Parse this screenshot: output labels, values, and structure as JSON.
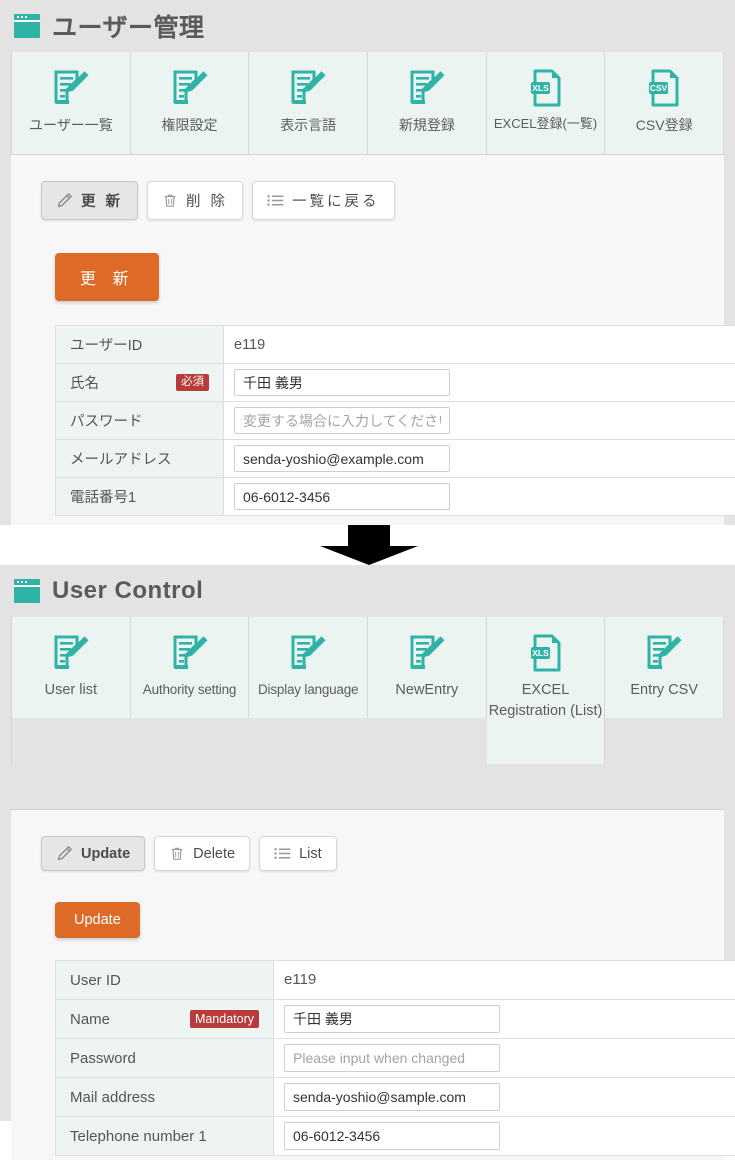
{
  "theme": {
    "accent_teal": "#2fb3a7",
    "orange": "#dd6b27",
    "required_red": "#b93a3a",
    "panel_gray": "#e3e3e3",
    "tab_mint": "#ecf4f2",
    "content_bg": "#f7f7f7"
  },
  "japanese_panel": {
    "window_icon": "window-icon",
    "title": "ユーザー管理",
    "tabs": [
      {
        "label": "ユーザー一覧",
        "icon": "document-pencil-icon"
      },
      {
        "label": "権限設定",
        "icon": "document-pencil-icon"
      },
      {
        "label": "表示言語",
        "icon": "document-pencil-icon"
      },
      {
        "label": "新規登録",
        "icon": "document-pencil-icon"
      },
      {
        "label": "EXCEL登録(一覧)",
        "icon": "xls-file-icon",
        "badge": "XLS"
      },
      {
        "label": "CSV登録",
        "icon": "csv-file-icon",
        "badge": "CSV"
      }
    ],
    "toolbar": [
      {
        "label": "更 新",
        "icon": "pencil-icon",
        "active": true
      },
      {
        "label": "削 除",
        "icon": "trash-icon",
        "active": false
      },
      {
        "label": "一覧に戻る",
        "icon": "list-icon",
        "active": false
      }
    ],
    "submit_button": "更 新",
    "required_badge": "必須",
    "form_rows": [
      {
        "label": "ユーザーID",
        "type": "static",
        "value": "e119",
        "required": false
      },
      {
        "label": "氏名",
        "type": "input",
        "value": "千田 義男",
        "placeholder": "",
        "required": true
      },
      {
        "label": "パスワード",
        "type": "input",
        "value": "",
        "placeholder": "変更する場合に入力してください",
        "required": false
      },
      {
        "label": "メールアドレス",
        "type": "input",
        "value": "senda-yoshio@example.com",
        "placeholder": "",
        "required": false
      },
      {
        "label": "電話番号1",
        "type": "input",
        "value": "06-6012-3456",
        "placeholder": "",
        "required": false
      }
    ]
  },
  "divider": {
    "icon": "down-arrow-icon"
  },
  "english_panel": {
    "window_icon": "window-icon",
    "title": "User Control",
    "tabs": [
      {
        "label": "User list",
        "icon": "document-pencil-icon"
      },
      {
        "label": "Authority setting",
        "icon": "document-pencil-icon"
      },
      {
        "label": "Display language",
        "icon": "document-pencil-icon"
      },
      {
        "label": "NewEntry",
        "icon": "document-pencil-icon"
      },
      {
        "label": "EXCEL Registration (List)",
        "icon": "xls-file-icon",
        "badge": "XLS"
      },
      {
        "label": "Entry CSV",
        "icon": "document-pencil-icon"
      }
    ],
    "toolbar": [
      {
        "label": "Update",
        "icon": "pencil-icon",
        "active": true
      },
      {
        "label": "Delete",
        "icon": "trash-icon",
        "active": false
      },
      {
        "label": "List",
        "icon": "list-icon",
        "active": false
      }
    ],
    "submit_button": "Update",
    "required_badge": "Mandatory",
    "form_rows": [
      {
        "label": "User ID",
        "type": "static",
        "value": "e119",
        "required": false
      },
      {
        "label": "Name",
        "type": "input",
        "value": "千田 義男",
        "placeholder": "",
        "required": true
      },
      {
        "label": "Password",
        "type": "input",
        "value": "",
        "placeholder": "Please input when changed",
        "required": false
      },
      {
        "label": "Mail address",
        "type": "input",
        "value": "senda-yoshio@sample.com",
        "placeholder": "",
        "required": false
      },
      {
        "label": "Telephone number 1",
        "type": "input",
        "value": "06-6012-3456",
        "placeholder": "",
        "required": false
      }
    ]
  }
}
